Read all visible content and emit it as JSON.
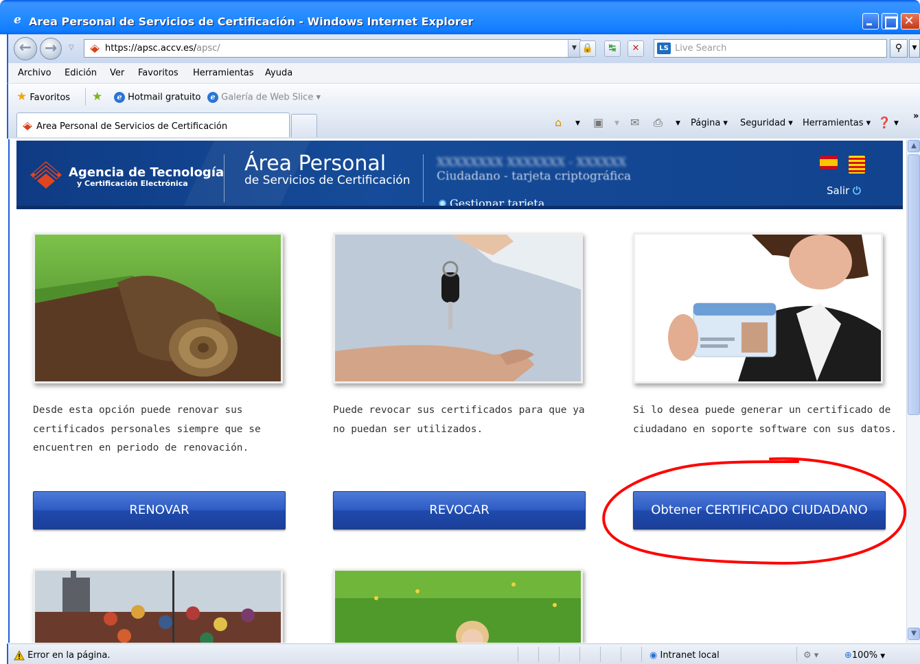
{
  "window": {
    "title": "Area Personal de Servicios de Certificación - Windows Internet Explorer",
    "minimize_icon": "minimize-icon",
    "maximize_icon": "maximize-icon",
    "close_icon": "close-icon"
  },
  "address_bar": {
    "url_host": "https://apsc.accv.es/",
    "url_path": "apsc/",
    "search_placeholder": "Live Search",
    "search_logo": "LS"
  },
  "menu": {
    "items": [
      "Archivo",
      "Edición",
      "Ver",
      "Favoritos",
      "Herramientas",
      "Ayuda"
    ]
  },
  "favorites_bar": {
    "favorites_label": "Favoritos",
    "links": [
      "Hotmail gratuito",
      "Galería de Web Slice ▾"
    ]
  },
  "tabs": {
    "active_tab": "Area Personal de Servicios de Certificación"
  },
  "command_bar": {
    "items": [
      "Página ▾",
      "Seguridad ▾",
      "Herramientas ▾"
    ]
  },
  "page": {
    "agency_line1": "Agencia de Tecnología",
    "agency_line2": "y Certificación Electrónica",
    "area_title": "Área Personal",
    "area_subtitle": "de Servicios de Certificación",
    "user_name": "XXXXXXXX XXXXXXX - XXXXXX",
    "card_type": "Ciudadano - tarjeta criptográfica",
    "manage_card": "Gestionar tarjeta",
    "logout": "Salir",
    "cards": [
      {
        "description": "Desde esta opción puede renovar sus certificados personales siempre que se encuentren en periodo de renovación.",
        "button": "RENOVAR"
      },
      {
        "description": "Puede revocar sus certificados para que ya no puedan ser utilizados.",
        "button": "REVOCAR"
      },
      {
        "description": "Si lo desea puede generar un certificado de ciudadano en soporte software con sus datos.",
        "button": "Obtener CERTIFICADO CIUDADANO"
      }
    ],
    "accent_color": "#1f4aad",
    "annotation_color": "#ff0000"
  },
  "status_bar": {
    "message": "Error en la página.",
    "zone": "Intranet local",
    "zoom": "100%"
  }
}
